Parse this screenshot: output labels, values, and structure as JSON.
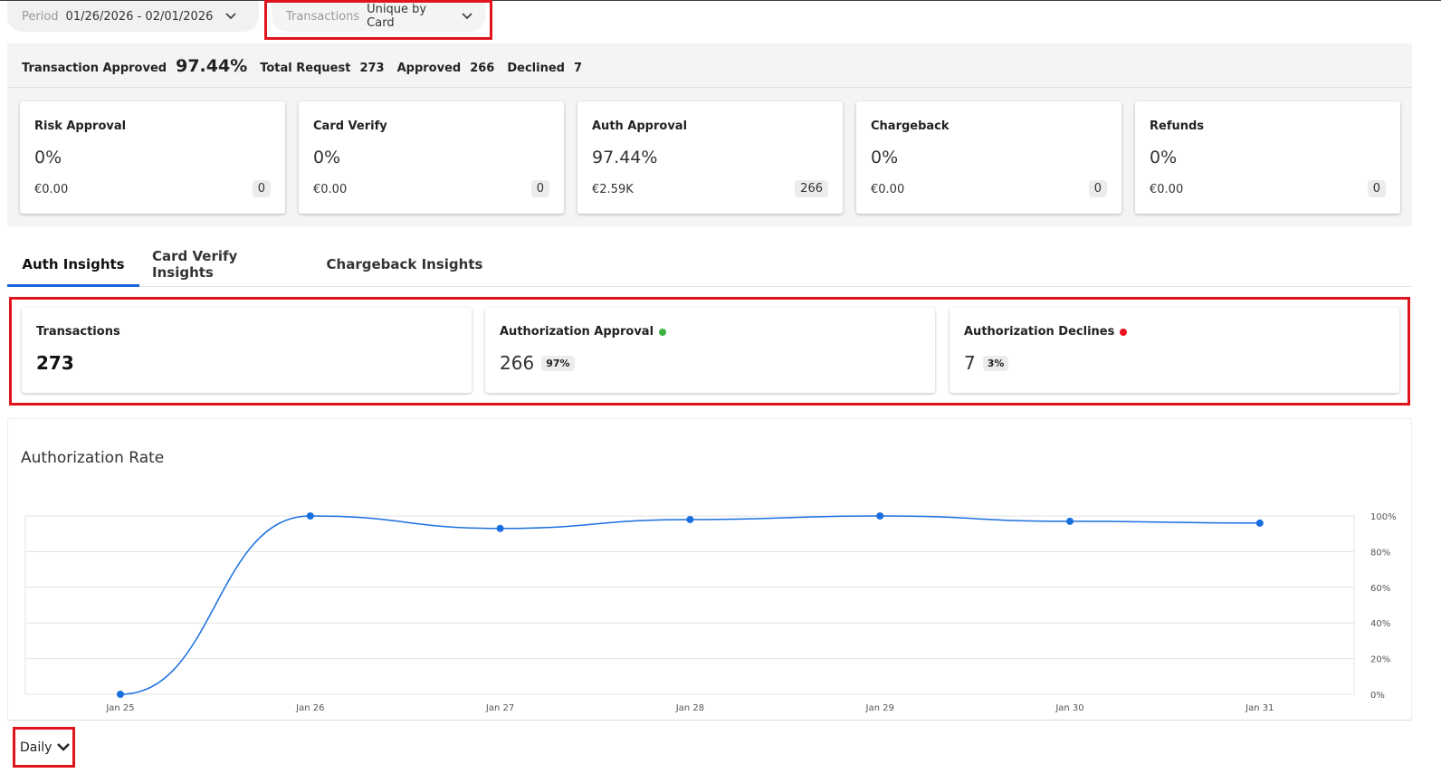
{
  "filters": {
    "period": {
      "label": "Period",
      "value": "01/26/2026 - 02/01/2026"
    },
    "transactions": {
      "label": "Transactions",
      "value": "Unique by Card"
    }
  },
  "summary": {
    "approved_label": "Transaction Approved",
    "approved_pct": "97.44%",
    "total_request_label": "Total Request",
    "total_request": "273",
    "approved_count_label": "Approved",
    "approved_count": "266",
    "declined_label": "Declined",
    "declined": "7"
  },
  "kpis": [
    {
      "title": "Risk Approval",
      "pct": "0%",
      "amount": "€0.00",
      "count": "0"
    },
    {
      "title": "Card Verify",
      "pct": "0%",
      "amount": "€0.00",
      "count": "0"
    },
    {
      "title": "Auth Approval",
      "pct": "97.44%",
      "amount": "€2.59K",
      "count": "266"
    },
    {
      "title": "Chargeback",
      "pct": "0%",
      "amount": "€0.00",
      "count": "0"
    },
    {
      "title": "Refunds",
      "pct": "0%",
      "amount": "€0.00",
      "count": "0"
    }
  ],
  "tabs": [
    "Auth Insights",
    "Card Verify Insights",
    "Chargeback Insights"
  ],
  "insights": {
    "transactions": {
      "title": "Transactions",
      "value": "273"
    },
    "approval": {
      "title": "Authorization Approval",
      "value": "266",
      "badge": "97%",
      "dot_color": "#3cb043"
    },
    "declines": {
      "title": "Authorization Declines",
      "value": "7",
      "badge": "3%",
      "dot_color": "#e8141d"
    }
  },
  "chart_title": "Authorization Rate",
  "chart_data": {
    "type": "line",
    "x": [
      "Jan 25",
      "Jan 26",
      "Jan 27",
      "Jan 28",
      "Jan 29",
      "Jan 30",
      "Jan 31"
    ],
    "series": [
      {
        "values": [
          0,
          100,
          93,
          98,
          100,
          97,
          96
        ]
      }
    ],
    "yticks": [
      "0%",
      "20%",
      "40%",
      "60%",
      "80%",
      "100%"
    ],
    "ylim": [
      0,
      100
    ],
    "grid": true,
    "y_axis_side": "right",
    "line_color": "#1a6fe0"
  },
  "granularity": {
    "value": "Daily"
  }
}
